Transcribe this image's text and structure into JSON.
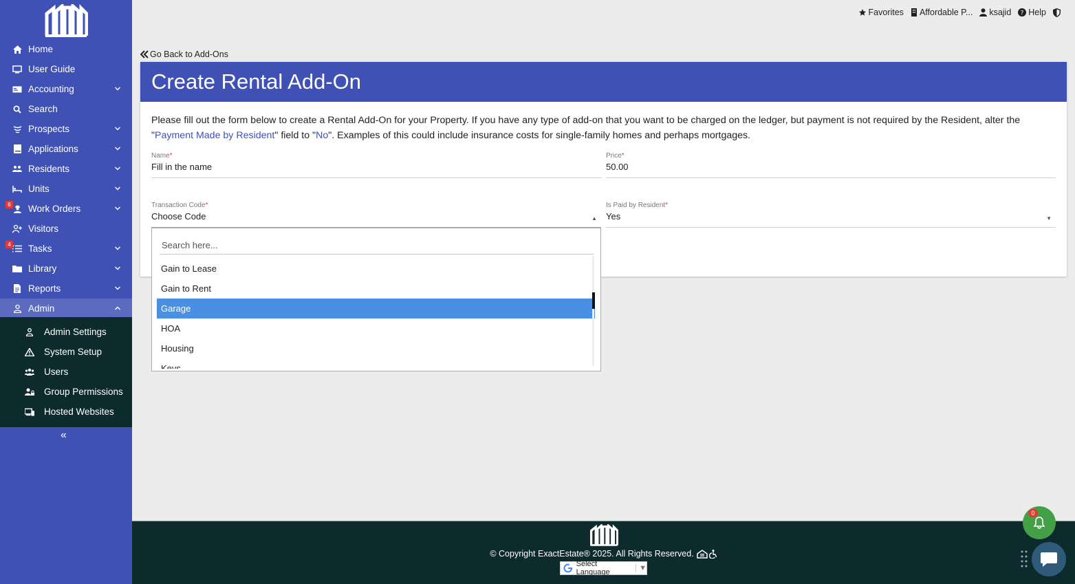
{
  "topbar": {
    "favorites": "Favorites",
    "property": "Affordable P...",
    "user": "ksajid",
    "help": "Help"
  },
  "sidebar": {
    "items": [
      {
        "label": "Home",
        "icon": "home-icon",
        "chevron": false
      },
      {
        "label": "User Guide",
        "icon": "guide-icon",
        "chevron": false
      },
      {
        "label": "Accounting",
        "icon": "money-icon",
        "chevron": true
      },
      {
        "label": "Search",
        "icon": "search-icon",
        "chevron": false
      },
      {
        "label": "Prospects",
        "icon": "funnel-icon",
        "chevron": true
      },
      {
        "label": "Applications",
        "icon": "book-icon",
        "chevron": true
      },
      {
        "label": "Residents",
        "icon": "people-icon",
        "chevron": true
      },
      {
        "label": "Units",
        "icon": "bed-icon",
        "chevron": true
      },
      {
        "label": "Work Orders",
        "icon": "worker-icon",
        "chevron": true,
        "badge": "6"
      },
      {
        "label": "Visitors",
        "icon": "user-plus-icon",
        "chevron": false
      },
      {
        "label": "Tasks",
        "icon": "list-icon",
        "chevron": true,
        "badge": "4"
      },
      {
        "label": "Library",
        "icon": "folder-icon",
        "chevron": true
      },
      {
        "label": "Reports",
        "icon": "file-icon",
        "chevron": true
      },
      {
        "label": "Admin",
        "icon": "admin-icon",
        "chevron": true,
        "active": true
      }
    ],
    "sub_items": [
      {
        "label": "Admin Settings",
        "icon": "admin-settings-icon"
      },
      {
        "label": "System Setup",
        "icon": "warning-icon"
      },
      {
        "label": "Users",
        "icon": "users-icon"
      },
      {
        "label": "Group Permissions",
        "icon": "group-lock-icon"
      },
      {
        "label": "Hosted Websites",
        "icon": "devices-icon"
      }
    ],
    "collapse": "«"
  },
  "back_link": "Go Back to Add-Ons",
  "card": {
    "title": "Create Rental Add-On",
    "intro_1": "Please fill out the form below to create a Rental Add-On for your Property. If you have any type of add-on that you want to be charged on the ledger, but payment is not required by the Resident, alter the \"",
    "intro_hl1": "Payment Made by Resident",
    "intro_2": "\" field to \"",
    "intro_hl2": "No",
    "intro_3": "\". Examples of this could include insurance costs for single-family homes and perhaps mortgages."
  },
  "form": {
    "name_label": "Name",
    "name_value": "Fill in the name",
    "price_label": "Price",
    "price_value": "50.00",
    "code_label": "Transaction Code",
    "code_value": "Choose Code",
    "paid_label": "Is Paid by Resident",
    "paid_value": "Yes",
    "required_mark": "*"
  },
  "dropdown": {
    "placeholder": "Search here...",
    "options": [
      "Gain to Lease",
      "Gain to Rent",
      "Garage",
      "HOA",
      "Housing",
      "Keys"
    ],
    "selected_index": 2
  },
  "footer": {
    "copyright": "© Copyright ExactEstate® 2025. All Rights Reserved.",
    "language": "Select Language"
  },
  "notifications": {
    "count": "0"
  },
  "colors": {
    "brand": "#3f51b5",
    "footer": "#0d2a2d",
    "selected": "#4a90e2",
    "bell": "#43a047"
  }
}
